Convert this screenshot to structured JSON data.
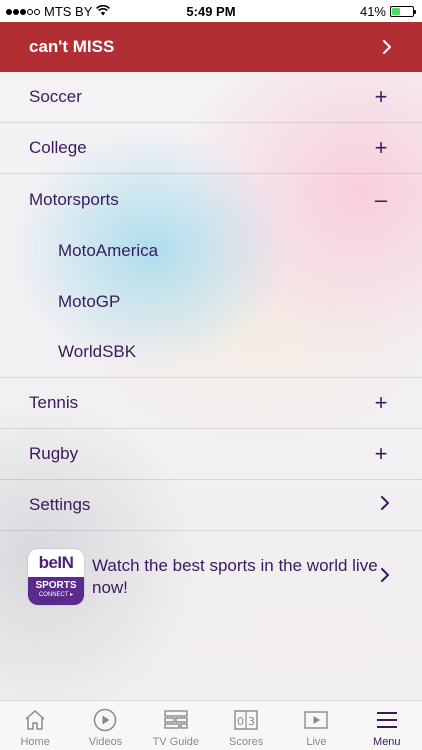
{
  "status_bar": {
    "carrier": "MTS BY",
    "time": "5:49 PM",
    "battery": "41%",
    "battery_level": 0.41,
    "signal_bars": 3
  },
  "header": {
    "title": "can't MISS"
  },
  "menu": {
    "items": [
      {
        "label": "Soccer",
        "toggle": "+"
      },
      {
        "label": "College",
        "toggle": "+"
      },
      {
        "label": "Motorsports",
        "toggle": "–"
      },
      {
        "label": "MotoAmerica"
      },
      {
        "label": "MotoGP"
      },
      {
        "label": "WorldSBK"
      },
      {
        "label": "Tennis",
        "toggle": "+"
      },
      {
        "label": "Rugby",
        "toggle": "+"
      },
      {
        "label": "Settings"
      }
    ],
    "promo": {
      "logo_top": "beIN",
      "logo_sports": "SPORTS",
      "logo_connect": "CONNECT ▸",
      "text": "Watch the best sports in the world live now!"
    }
  },
  "tabbar": {
    "tabs": [
      {
        "label": "Home",
        "icon": "home-icon"
      },
      {
        "label": "Videos",
        "icon": "play-circle-icon"
      },
      {
        "label": "TV Guide",
        "icon": "tv-guide-icon"
      },
      {
        "label": "Scores",
        "icon": "scores-icon"
      },
      {
        "label": "Live",
        "icon": "live-icon"
      },
      {
        "label": "Menu",
        "icon": "menu-icon"
      }
    ],
    "active": "Menu"
  },
  "colors": {
    "header_bg": "#b12e34",
    "text": "#3a1a5e",
    "brand_purple": "#5a2a8c"
  }
}
